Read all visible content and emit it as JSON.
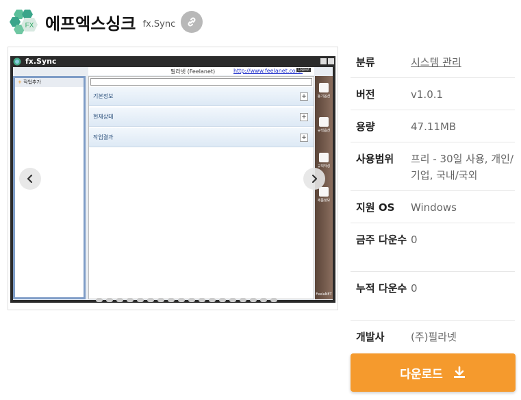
{
  "header": {
    "title": "에프엑스싱크",
    "subtitle": "fx.Sync",
    "logo_text": "FX"
  },
  "screenshot": {
    "window_title": "fx.Sync",
    "user": "필라넷 (Feelanet)",
    "url": "http://www.feelanet.co.kr",
    "login_label": "Logout",
    "left_panel_header": "작업추가",
    "rows": [
      "기본정보",
      "현재상태",
      "작업결과"
    ],
    "side_tools": [
      "동기옵션",
      "규칙옵션",
      "규칙작성",
      "제품정보"
    ],
    "brand_footer": "FeelaNET",
    "slide_count": 18
  },
  "info": [
    {
      "label": "분류",
      "value": "시스템 관리",
      "link": true
    },
    {
      "label": "버전",
      "value": "v1.0.1"
    },
    {
      "label": "용량",
      "value": "47.11MB"
    },
    {
      "label": "사용범위",
      "value": "프리 - 30일 사용, 개인/기업, 국내/국외"
    },
    {
      "label": "지원 OS",
      "value": "Windows"
    },
    {
      "label": "금주 다운수",
      "value": "0"
    },
    {
      "label": "누적 다운수",
      "value": "0"
    },
    {
      "label": "개발사",
      "value": "(주)필라넷"
    }
  ],
  "download": {
    "label": "다운로드"
  },
  "colors": {
    "accent": "#f59a2d",
    "logo_green": "#3aa58a"
  },
  "icons": {
    "link": "link-icon",
    "download": "download-icon",
    "prev": "chevron-left-icon",
    "next": "chevron-right-icon"
  }
}
